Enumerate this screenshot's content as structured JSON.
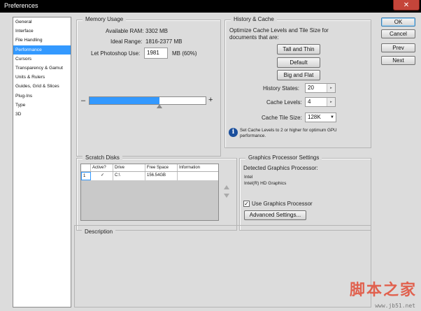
{
  "window": {
    "title": "Preferences"
  },
  "nav": {
    "items": [
      {
        "label": "General"
      },
      {
        "label": "Interface"
      },
      {
        "label": "File Handling"
      },
      {
        "label": "Performance"
      },
      {
        "label": "Cursors"
      },
      {
        "label": "Transparency & Gamut"
      },
      {
        "label": "Units & Rulers"
      },
      {
        "label": "Guides, Grid & Slices"
      },
      {
        "label": "Plug-Ins"
      },
      {
        "label": "Type"
      },
      {
        "label": "3D"
      }
    ],
    "selected": "Performance"
  },
  "memory": {
    "title": "Memory Usage",
    "available_label": "Available RAM:",
    "available_value": "3302 MB",
    "ideal_label": "Ideal Range:",
    "ideal_value": "1816-2377 MB",
    "let_label": "Let Photoshop Use:",
    "let_value": "1981",
    "let_suffix": "MB (60%)",
    "minus": "–",
    "plus": "+",
    "slider_fraction": 0.6
  },
  "history": {
    "title": "History & Cache",
    "desc": "Optimize Cache Levels and Tile Size for documents that are:",
    "btn_tall": "Tall and Thin",
    "btn_default": "Default",
    "btn_big": "Big and Flat",
    "states_label": "History States:",
    "states_value": "20",
    "levels_label": "Cache Levels:",
    "levels_value": "4",
    "tile_label": "Cache Tile Size:",
    "tile_value": "128K",
    "info_glyph": "i",
    "info_text": "Set Cache Levels to 2 or higher for optimum GPU performance."
  },
  "actions": {
    "ok": "OK",
    "cancel": "Cancel",
    "prev": "Prev",
    "next": "Next"
  },
  "scratch": {
    "title": "Scratch Disks",
    "columns": [
      "",
      "Active?",
      "Drive",
      "Free Space",
      "Information"
    ],
    "rows": [
      {
        "index": "1",
        "active": "✓",
        "drive": "C:\\",
        "free": "156.54GB",
        "info": ""
      }
    ]
  },
  "gpu": {
    "title": "Graphics Processor Settings",
    "detected_label": "Detected Graphics Processor:",
    "vendor": "Intel",
    "model": "Intel(R) HD Graphics",
    "use_label": "Use Graphics Processor",
    "use_checked": "✓",
    "advanced_btn": "Advanced Settings..."
  },
  "description": {
    "title": "Description"
  },
  "watermark": {
    "main": "脚本之家",
    "sub": "www.jb51.net"
  }
}
